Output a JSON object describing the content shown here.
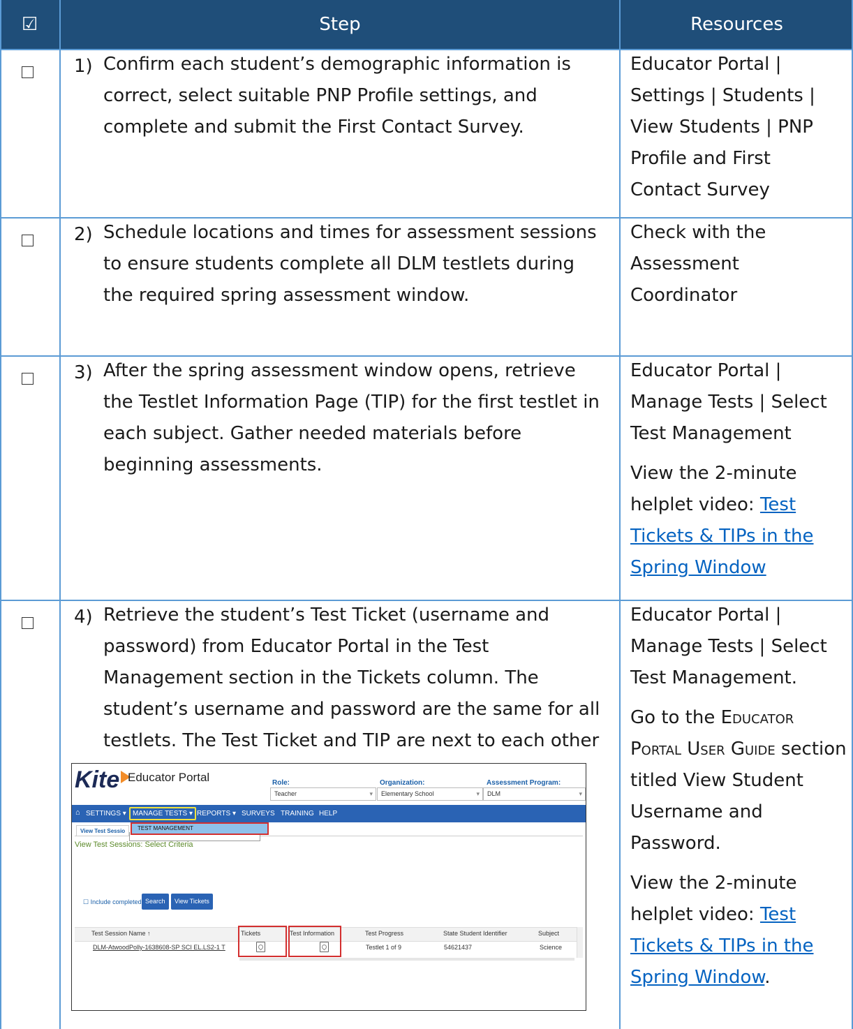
{
  "header": {
    "check_symbol": "☑",
    "step": "Step",
    "resources": "Resources"
  },
  "rows": [
    {
      "num": "1)",
      "step": "Confirm each student’s demographic information is correct, select suitable PNP Profile settings, and complete and submit the First Contact Survey.",
      "resources": "Educator Portal | Settings | Students | View Students | PNP Profile and First Contact Survey"
    },
    {
      "num": "2)",
      "step": "Schedule locations and times for assessment sessions to ensure students complete all DLM testlets during the required spring assessment window.",
      "resources": "Check with the Assessment Coordinator"
    },
    {
      "num": "3)",
      "step": "After the spring assessment window opens, retrieve the Testlet Information Page (TIP) for the first testlet in each subject. Gather needed materials before beginning assessments.",
      "resources": "Educator Portal | Manage Tests | Select Test Management",
      "resources_2_prefix": "View the 2-minute helplet video: ",
      "resources_2_link": "Test Tickets & TIPs in the Spring Window"
    },
    {
      "num": "4)",
      "step": "Retrieve the student’s Test Ticket (username and password) from Educator Portal in the Test Management section in the Tickets column. The student’s username and password are the same for all testlets. The Test Ticket and TIP are next to each other as depicted in the following screenshot.",
      "resources": "Educator Portal | Manage Tests | Select Test Management.",
      "resources_2_prefix": "Go to the ",
      "resources_2_smallcaps": "Educator Portal User Guide",
      "resources_2_suffix": " section titled View Student Username and Password.",
      "resources_3_prefix": "View the 2-minute helplet video: ",
      "resources_3_link": "Test Tickets & TIPs in the Spring Window",
      "resources_3_suffix": "."
    }
  ],
  "screenshot": {
    "logo": "Kite",
    "portal_title": "Educator Portal",
    "role_label": "Role:",
    "role_value": "Teacher",
    "org_label": "Organization:",
    "org_value": "Elementary School",
    "program_label": "Assessment Program:",
    "program_value": "DLM",
    "nav": [
      "SETTINGS ▾",
      "MANAGE TESTS ▾",
      "REPORTS ▾",
      "SURVEYS",
      "TRAINING",
      "HELP"
    ],
    "submenu": "TEST MANAGEMENT",
    "tab": "View Test Sessio",
    "criteria": "View Test Sessions: Select Criteria",
    "include_completed": "☐ Include completed",
    "search_btn": "Search",
    "view_tickets_btn": "View Tickets",
    "columns": [
      "Test Session Name ↑",
      "Tickets",
      "Test Information",
      "Test Progress",
      "State Student Identifier",
      "Subject"
    ],
    "row": {
      "session": "DLM-AtwoodPolly-1638608-SP SCI EL.LS2-1 T",
      "progress": "Testlet 1 of 9",
      "ssid": "54621437",
      "subject": "Science"
    }
  }
}
